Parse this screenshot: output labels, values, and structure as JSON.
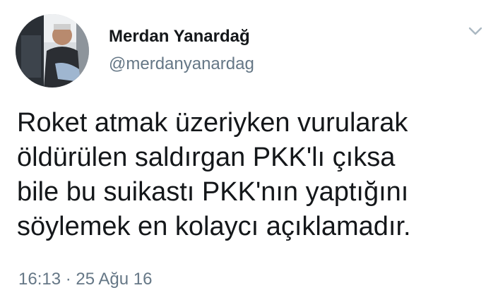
{
  "author": {
    "display_name": "Merdan Yanardağ",
    "handle": "@merdanyanardag",
    "avatar_icon": "profile-photo-icon"
  },
  "menu": {
    "icon": "chevron-down-icon"
  },
  "tweet": {
    "lines": [
      "Roket atmak üzeriyken vurularak",
      "öldürülen saldırgan PKK'lı çıksa",
      "bile bu suikastı PKK'nın yaptığını",
      "söylemek en kolaycı açıklamadır."
    ],
    "timestamp": "16:13 · 25 Ağu 16"
  },
  "colors": {
    "text": "#14171a",
    "secondary": "#657786",
    "chevron": "#aab8c2"
  }
}
